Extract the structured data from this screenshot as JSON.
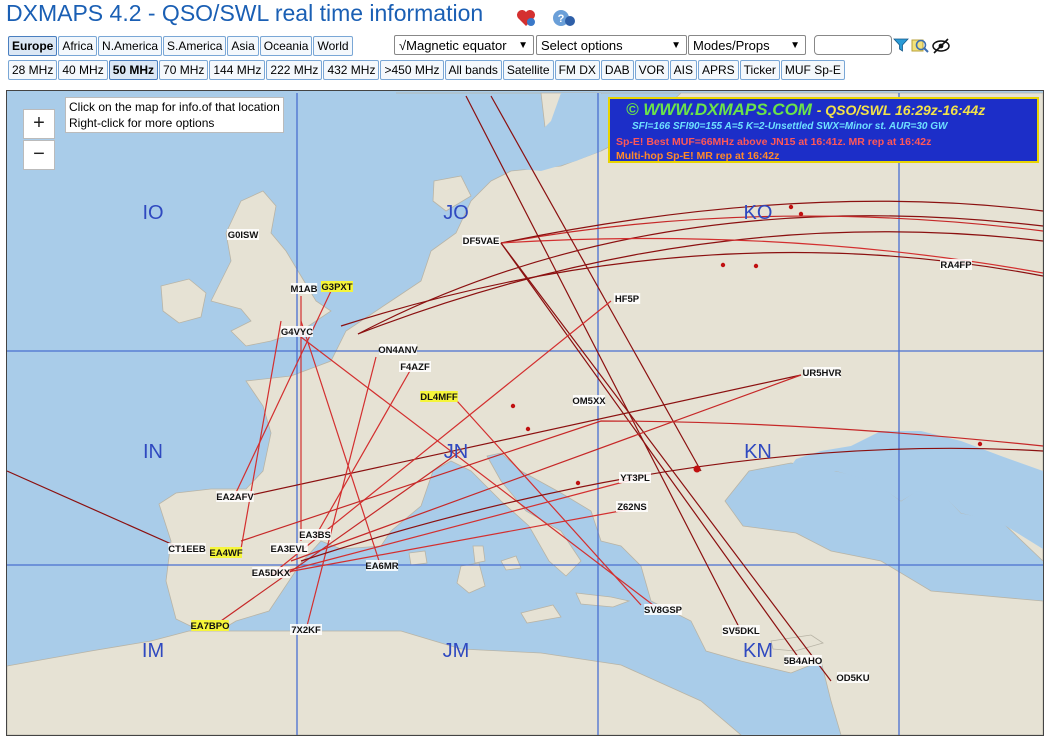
{
  "header": {
    "title": "DXMAPS 4.2 - QSO/SWL real time information"
  },
  "region_tabs": [
    "Europe",
    "Africa",
    "N.America",
    "S.America",
    "Asia",
    "Oceania",
    "World"
  ],
  "selected_region": "Europe",
  "filters": {
    "equator": "√Magnetic equator",
    "options": "Select options",
    "modes": "Modes/Props",
    "search_value": ""
  },
  "band_tabs": [
    "28 MHz",
    "40 MHz",
    "50 MHz",
    "70 MHz",
    "144 MHz",
    "222 MHz",
    "432 MHz",
    ">450 MHz",
    "All bands",
    "Satellite",
    "FM DX",
    "DAB",
    "VOR",
    "AIS",
    "APRS",
    "Ticker",
    "MUF Sp-E"
  ],
  "selected_band": "50 MHz",
  "map": {
    "zoom_in": "+",
    "zoom_out": "−",
    "hint_line1": "Click on the map for info.of that location",
    "hint_line2": "Right-click for more options",
    "info": {
      "site": "© WWW.DXMAPS.COM",
      "subtitle": "- QSO/SWL 16:29z-16:44z",
      "indices": "SFI=166 SFI90=155 A=5 K=2-Unsettled SWX=Minor st. AUR=30 GW",
      "spe_line": "Sp-E! Best MUF=66MHz above JN15 at 16:41z. MR rep at 16:42z",
      "multihop_line": "Multi-hop Sp-E! MR rep at 16:42z"
    },
    "grid_labels": [
      "IO",
      "JO",
      "KO",
      "IN",
      "JN",
      "KN",
      "IM",
      "JM",
      "KM"
    ],
    "stations": [
      "G0ISW",
      "DF5VAE",
      "RA4FP",
      "M1AB",
      "G3PXT",
      "HF5P",
      "G4VYC",
      "ON4ANV",
      "F4AZF",
      "UR5HVR",
      "DL4MFF",
      "OM5XX",
      "EA2AFV",
      "YT3PL",
      "Z62NS",
      "EA3BS",
      "CT1EEB",
      "EA4WF",
      "EA3EVL",
      "EA5DKX",
      "EA6MR",
      "SV8GSP",
      "EA7BPO",
      "7X2KF",
      "SV5DKL",
      "5B4AHO",
      "OD5KU"
    ],
    "highlighted_stations": [
      "G3PXT",
      "DL4MFF",
      "EA4WF",
      "EA7BPO"
    ]
  }
}
